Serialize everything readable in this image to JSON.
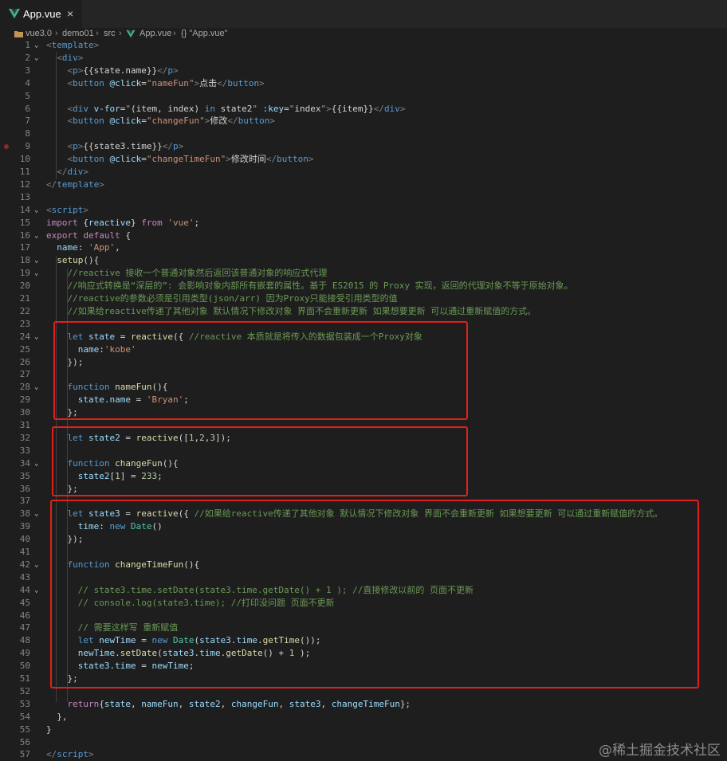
{
  "tab": {
    "label": "App.vue",
    "close": "×",
    "icon": "vue-logo-icon"
  },
  "breadcrumb": [
    "vue3.0",
    "demo01",
    "src",
    "App.vue",
    "{} \"App.vue\""
  ],
  "watermark": "@稀土掘金技术社区",
  "colors": {
    "highlight_box": "#e0201c",
    "editor_bg": "#1e1e1e"
  },
  "lines": [
    {
      "n": "1",
      "f": "⌄",
      "s": [
        [
          "tb",
          "<"
        ],
        [
          "tg",
          "template"
        ],
        [
          "tb",
          ">"
        ]
      ]
    },
    {
      "n": "2",
      "f": "⌄",
      "s": [
        [
          "tx",
          "  "
        ],
        [
          "tb",
          "<"
        ],
        [
          "tg",
          "div"
        ],
        [
          "tb",
          ">"
        ]
      ]
    },
    {
      "n": "3",
      "s": [
        [
          "tx",
          "    "
        ],
        [
          "tb",
          "<"
        ],
        [
          "tg",
          "p"
        ],
        [
          "tb",
          ">"
        ],
        [
          "tx",
          "{{state.name}}"
        ],
        [
          "tb",
          "</"
        ],
        [
          "tg",
          "p"
        ],
        [
          "tb",
          ">"
        ]
      ]
    },
    {
      "n": "4",
      "s": [
        [
          "tx",
          "    "
        ],
        [
          "tb",
          "<"
        ],
        [
          "tg",
          "button"
        ],
        [
          "tx",
          " "
        ],
        [
          "at",
          "@click"
        ],
        [
          "tx",
          "="
        ],
        [
          "st",
          "\"nameFun\""
        ],
        [
          "tb",
          ">"
        ],
        [
          "tx",
          "点击"
        ],
        [
          "tb",
          "</"
        ],
        [
          "tg",
          "button"
        ],
        [
          "tb",
          ">"
        ]
      ]
    },
    {
      "n": "5",
      "s": []
    },
    {
      "n": "6",
      "s": [
        [
          "tx",
          "    "
        ],
        [
          "tb",
          "<"
        ],
        [
          "tg",
          "div"
        ],
        [
          "tx",
          " "
        ],
        [
          "at",
          "v-for"
        ],
        [
          "tx",
          "="
        ],
        [
          "st",
          "\""
        ],
        [
          "tx",
          "(item, index) "
        ],
        [
          "bl",
          "in"
        ],
        [
          "tx",
          " state2"
        ],
        [
          "st",
          "\""
        ],
        [
          "tx",
          " "
        ],
        [
          "at",
          ":key"
        ],
        [
          "tx",
          "="
        ],
        [
          "st",
          "\""
        ],
        [
          "tx",
          "index"
        ],
        [
          "st",
          "\""
        ],
        [
          "tb",
          ">"
        ],
        [
          "tx",
          "{{item}}"
        ],
        [
          "tb",
          "</"
        ],
        [
          "tg",
          "div"
        ],
        [
          "tb",
          ">"
        ]
      ]
    },
    {
      "n": "7",
      "s": [
        [
          "tx",
          "    "
        ],
        [
          "tb",
          "<"
        ],
        [
          "tg",
          "button"
        ],
        [
          "tx",
          " "
        ],
        [
          "at",
          "@click"
        ],
        [
          "tx",
          "="
        ],
        [
          "st",
          "\"changeFun\""
        ],
        [
          "tb",
          ">"
        ],
        [
          "tx",
          "修改"
        ],
        [
          "tb",
          "</"
        ],
        [
          "tg",
          "button"
        ],
        [
          "tb",
          ">"
        ]
      ]
    },
    {
      "n": "8",
      "s": []
    },
    {
      "n": "9",
      "bp": true,
      "s": [
        [
          "tx",
          "    "
        ],
        [
          "tb",
          "<"
        ],
        [
          "tg",
          "p"
        ],
        [
          "tb",
          ">"
        ],
        [
          "tx",
          "{{state3.time}}"
        ],
        [
          "tb",
          "</"
        ],
        [
          "tg",
          "p"
        ],
        [
          "tb",
          ">"
        ]
      ]
    },
    {
      "n": "10",
      "s": [
        [
          "tx",
          "    "
        ],
        [
          "tb",
          "<"
        ],
        [
          "tg",
          "button"
        ],
        [
          "tx",
          " "
        ],
        [
          "at",
          "@click"
        ],
        [
          "tx",
          "="
        ],
        [
          "st",
          "\"changeTimeFun\""
        ],
        [
          "tb",
          ">"
        ],
        [
          "tx",
          "修改时间"
        ],
        [
          "tb",
          "</"
        ],
        [
          "tg",
          "button"
        ],
        [
          "tb",
          ">"
        ]
      ]
    },
    {
      "n": "11",
      "s": [
        [
          "tx",
          "  "
        ],
        [
          "tb",
          "</"
        ],
        [
          "tg",
          "div"
        ],
        [
          "tb",
          ">"
        ]
      ]
    },
    {
      "n": "12",
      "s": [
        [
          "tb",
          "</"
        ],
        [
          "tg",
          "template"
        ],
        [
          "tb",
          ">"
        ]
      ]
    },
    {
      "n": "13",
      "s": []
    },
    {
      "n": "14",
      "f": "⌄",
      "s": [
        [
          "tb",
          "<"
        ],
        [
          "tg",
          "script"
        ],
        [
          "tb",
          ">"
        ]
      ]
    },
    {
      "n": "15",
      "s": [
        [
          "kw",
          "import"
        ],
        [
          "tx",
          " {"
        ],
        [
          "vr",
          "reactive"
        ],
        [
          "tx",
          "} "
        ],
        [
          "kw",
          "from"
        ],
        [
          "tx",
          " "
        ],
        [
          "st",
          "'vue'"
        ],
        [
          "tx",
          ";"
        ]
      ]
    },
    {
      "n": "16",
      "f": "⌄",
      "s": [
        [
          "kw",
          "export"
        ],
        [
          "tx",
          " "
        ],
        [
          "kw",
          "default"
        ],
        [
          "tx",
          " {"
        ]
      ]
    },
    {
      "n": "17",
      "s": [
        [
          "tx",
          "  "
        ],
        [
          "vr",
          "name"
        ],
        [
          "tx",
          ": "
        ],
        [
          "st",
          "'App'"
        ],
        [
          "tx",
          ","
        ]
      ]
    },
    {
      "n": "18",
      "f": "⌄",
      "s": [
        [
          "tx",
          "  "
        ],
        [
          "fn",
          "setup"
        ],
        [
          "tx",
          "(){"
        ]
      ]
    },
    {
      "n": "19",
      "f": "⌄",
      "s": [
        [
          "tx",
          "    "
        ],
        [
          "cm",
          "//reactive 接收一个普通对象然后返回该普通对象的响应式代理"
        ]
      ]
    },
    {
      "n": "20",
      "s": [
        [
          "tx",
          "    "
        ],
        [
          "cm",
          "//响应式转换是“深层的”: 会影响对象内部所有嵌套的属性。基于 ES2015 的 Proxy 实现，返回的代理对象不等于原始对象。"
        ]
      ]
    },
    {
      "n": "21",
      "s": [
        [
          "tx",
          "    "
        ],
        [
          "cm",
          "//reactive的参数必须是引用类型(json/arr) 因为Proxy只能接受引用类型的值"
        ]
      ]
    },
    {
      "n": "22",
      "s": [
        [
          "tx",
          "    "
        ],
        [
          "cm",
          "//如果给reactive传递了其他对象 默认情况下修改对象 界面不会重新更新 如果想要更新 可以通过重新赋值的方式。"
        ]
      ]
    },
    {
      "n": "23",
      "s": []
    },
    {
      "n": "24",
      "f": "⌄",
      "s": [
        [
          "tx",
          "    "
        ],
        [
          "bl",
          "let"
        ],
        [
          "tx",
          " "
        ],
        [
          "vr",
          "state"
        ],
        [
          "tx",
          " = "
        ],
        [
          "fn",
          "reactive"
        ],
        [
          "tx",
          "({ "
        ],
        [
          "cm",
          "//reactive 本质就是将传入的数据包装成一个Proxy对象"
        ]
      ]
    },
    {
      "n": "25",
      "s": [
        [
          "tx",
          "      "
        ],
        [
          "vr",
          "name"
        ],
        [
          "tx",
          ":"
        ],
        [
          "st",
          "'kobe'"
        ]
      ]
    },
    {
      "n": "26",
      "s": [
        [
          "tx",
          "    });"
        ]
      ]
    },
    {
      "n": "27",
      "s": []
    },
    {
      "n": "28",
      "f": "⌄",
      "s": [
        [
          "tx",
          "    "
        ],
        [
          "bl",
          "function"
        ],
        [
          "tx",
          " "
        ],
        [
          "fn",
          "nameFun"
        ],
        [
          "tx",
          "(){"
        ]
      ]
    },
    {
      "n": "29",
      "s": [
        [
          "tx",
          "      "
        ],
        [
          "vr",
          "state"
        ],
        [
          "tx",
          "."
        ],
        [
          "vr",
          "name"
        ],
        [
          "tx",
          " = "
        ],
        [
          "st",
          "'Bryan'"
        ],
        [
          "tx",
          ";"
        ]
      ]
    },
    {
      "n": "30",
      "s": [
        [
          "tx",
          "    };"
        ]
      ]
    },
    {
      "n": "31",
      "s": []
    },
    {
      "n": "32",
      "s": [
        [
          "tx",
          "    "
        ],
        [
          "bl",
          "let"
        ],
        [
          "tx",
          " "
        ],
        [
          "vr",
          "state2"
        ],
        [
          "tx",
          " = "
        ],
        [
          "fn",
          "reactive"
        ],
        [
          "tx",
          "(["
        ],
        [
          "nm",
          "1"
        ],
        [
          "tx",
          ","
        ],
        [
          "nm",
          "2"
        ],
        [
          "tx",
          ","
        ],
        [
          "nm",
          "3"
        ],
        [
          "tx",
          "]);"
        ]
      ]
    },
    {
      "n": "33",
      "s": []
    },
    {
      "n": "34",
      "f": "⌄",
      "s": [
        [
          "tx",
          "    "
        ],
        [
          "bl",
          "function"
        ],
        [
          "tx",
          " "
        ],
        [
          "fn",
          "changeFun"
        ],
        [
          "tx",
          "(){"
        ]
      ]
    },
    {
      "n": "35",
      "s": [
        [
          "tx",
          "      "
        ],
        [
          "vr",
          "state2"
        ],
        [
          "tx",
          "["
        ],
        [
          "nm",
          "1"
        ],
        [
          "tx",
          "] = "
        ],
        [
          "nm",
          "233"
        ],
        [
          "tx",
          ";"
        ]
      ]
    },
    {
      "n": "36",
      "s": [
        [
          "tx",
          "    };"
        ]
      ]
    },
    {
      "n": "37",
      "s": []
    },
    {
      "n": "38",
      "f": "⌄",
      "s": [
        [
          "tx",
          "    "
        ],
        [
          "bl",
          "let"
        ],
        [
          "tx",
          " "
        ],
        [
          "vr",
          "state3"
        ],
        [
          "tx",
          " = "
        ],
        [
          "fn",
          "reactive"
        ],
        [
          "tx",
          "({ "
        ],
        [
          "cm",
          "//如果给reactive传递了其他对象 默认情况下修改对象 界面不会重新更新 如果想要更新 可以通过重新赋值的方式。"
        ]
      ]
    },
    {
      "n": "39",
      "s": [
        [
          "tx",
          "      "
        ],
        [
          "vr",
          "time"
        ],
        [
          "tx",
          ": "
        ],
        [
          "bl",
          "new"
        ],
        [
          "tx",
          " "
        ],
        [
          "cl",
          "Date"
        ],
        [
          "tx",
          "()"
        ]
      ]
    },
    {
      "n": "40",
      "s": [
        [
          "tx",
          "    });"
        ]
      ]
    },
    {
      "n": "41",
      "s": []
    },
    {
      "n": "42",
      "f": "⌄",
      "s": [
        [
          "tx",
          "    "
        ],
        [
          "bl",
          "function"
        ],
        [
          "tx",
          " "
        ],
        [
          "fn",
          "changeTimeFun"
        ],
        [
          "tx",
          "(){"
        ]
      ]
    },
    {
      "n": "43",
      "s": []
    },
    {
      "n": "44",
      "f": "⌄",
      "s": [
        [
          "tx",
          "      "
        ],
        [
          "cm",
          "// state3.time.setDate(state3.time.getDate() + 1 ); //直接修改以前的 页面不更新"
        ]
      ]
    },
    {
      "n": "45",
      "s": [
        [
          "tx",
          "      "
        ],
        [
          "cm",
          "// console.log(state3.time); //打印没问题 页面不更新"
        ]
      ]
    },
    {
      "n": "46",
      "s": []
    },
    {
      "n": "47",
      "s": [
        [
          "tx",
          "      "
        ],
        [
          "cm",
          "// 需要这样写 重新赋值"
        ]
      ]
    },
    {
      "n": "48",
      "s": [
        [
          "tx",
          "      "
        ],
        [
          "bl",
          "let"
        ],
        [
          "tx",
          " "
        ],
        [
          "vr",
          "newTime"
        ],
        [
          "tx",
          " = "
        ],
        [
          "bl",
          "new"
        ],
        [
          "tx",
          " "
        ],
        [
          "cl",
          "Date"
        ],
        [
          "tx",
          "("
        ],
        [
          "vr",
          "state3"
        ],
        [
          "tx",
          "."
        ],
        [
          "vr",
          "time"
        ],
        [
          "tx",
          "."
        ],
        [
          "fn",
          "getTime"
        ],
        [
          "tx",
          "());"
        ]
      ]
    },
    {
      "n": "49",
      "s": [
        [
          "tx",
          "      "
        ],
        [
          "vr",
          "newTime"
        ],
        [
          "tx",
          "."
        ],
        [
          "fn",
          "setDate"
        ],
        [
          "tx",
          "("
        ],
        [
          "vr",
          "state3"
        ],
        [
          "tx",
          "."
        ],
        [
          "vr",
          "time"
        ],
        [
          "tx",
          "."
        ],
        [
          "fn",
          "getDate"
        ],
        [
          "tx",
          "() + "
        ],
        [
          "nm",
          "1"
        ],
        [
          "tx",
          " );"
        ]
      ]
    },
    {
      "n": "50",
      "s": [
        [
          "tx",
          "      "
        ],
        [
          "vr",
          "state3"
        ],
        [
          "tx",
          "."
        ],
        [
          "vr",
          "time"
        ],
        [
          "tx",
          " = "
        ],
        [
          "vr",
          "newTime"
        ],
        [
          "tx",
          ";"
        ]
      ]
    },
    {
      "n": "51",
      "s": [
        [
          "tx",
          "    };"
        ]
      ]
    },
    {
      "n": "52",
      "s": []
    },
    {
      "n": "53",
      "s": [
        [
          "tx",
          "    "
        ],
        [
          "kw",
          "return"
        ],
        [
          "tx",
          "{"
        ],
        [
          "vr",
          "state"
        ],
        [
          "tx",
          ", "
        ],
        [
          "vr",
          "nameFun"
        ],
        [
          "tx",
          ", "
        ],
        [
          "vr",
          "state2"
        ],
        [
          "tx",
          ", "
        ],
        [
          "vr",
          "changeFun"
        ],
        [
          "tx",
          ", "
        ],
        [
          "vr",
          "state3"
        ],
        [
          "tx",
          ", "
        ],
        [
          "vr",
          "changeTimeFun"
        ],
        [
          "tx",
          "};"
        ]
      ]
    },
    {
      "n": "54",
      "s": [
        [
          "tx",
          "  },"
        ]
      ]
    },
    {
      "n": "55",
      "s": [
        [
          "tx",
          "}"
        ]
      ]
    },
    {
      "n": "56",
      "s": []
    },
    {
      "n": "57",
      "s": [
        [
          "tb",
          "</"
        ],
        [
          "tg",
          "script"
        ],
        [
          "tb",
          ">"
        ]
      ]
    }
  ]
}
